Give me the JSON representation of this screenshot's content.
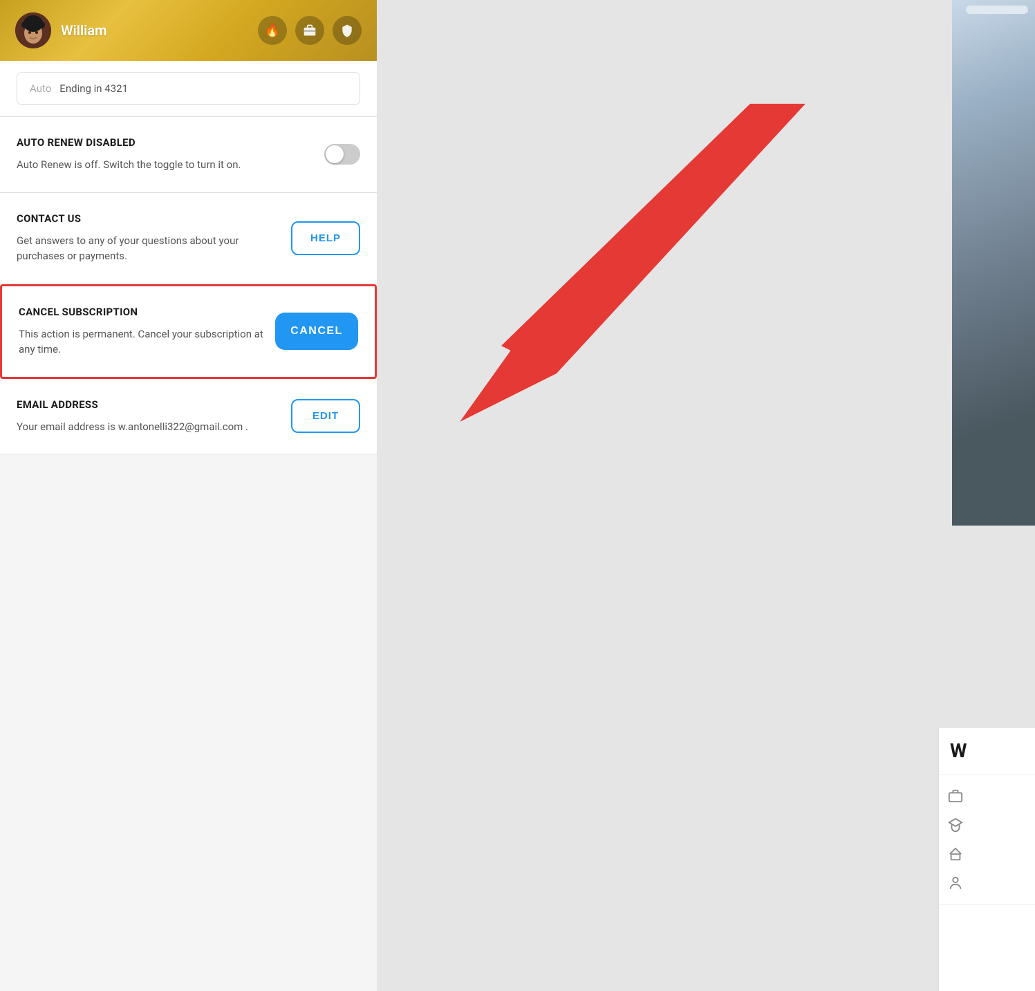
{
  "header": {
    "username": "William",
    "icons": {
      "flame": "🔥",
      "briefcase": "💼",
      "shield": "🛡"
    }
  },
  "payment": {
    "label": "Ending in 4321",
    "prefix": "Auto"
  },
  "auto_renew": {
    "title": "AUTO RENEW DISABLED",
    "description": "Auto Renew is off. Switch the toggle to turn it on.",
    "toggle_state": "off"
  },
  "contact_us": {
    "title": "CONTACT US",
    "description": "Get answers to any of your questions about your purchases or payments.",
    "button_label": "HELP"
  },
  "cancel_subscription": {
    "title": "CANCEL SUBSCRIPTION",
    "description": "This action is permanent. Cancel your subscription at any time.",
    "button_label": "CANCEL"
  },
  "email_address": {
    "title": "EMAIL ADDRESS",
    "description": "Your email address is w.antonelli322@gmail.com .",
    "button_label": "EDIT"
  },
  "bottom_right": {
    "initial": "W",
    "icons": [
      "briefcase",
      "graduation-cap",
      "home",
      "person"
    ]
  }
}
